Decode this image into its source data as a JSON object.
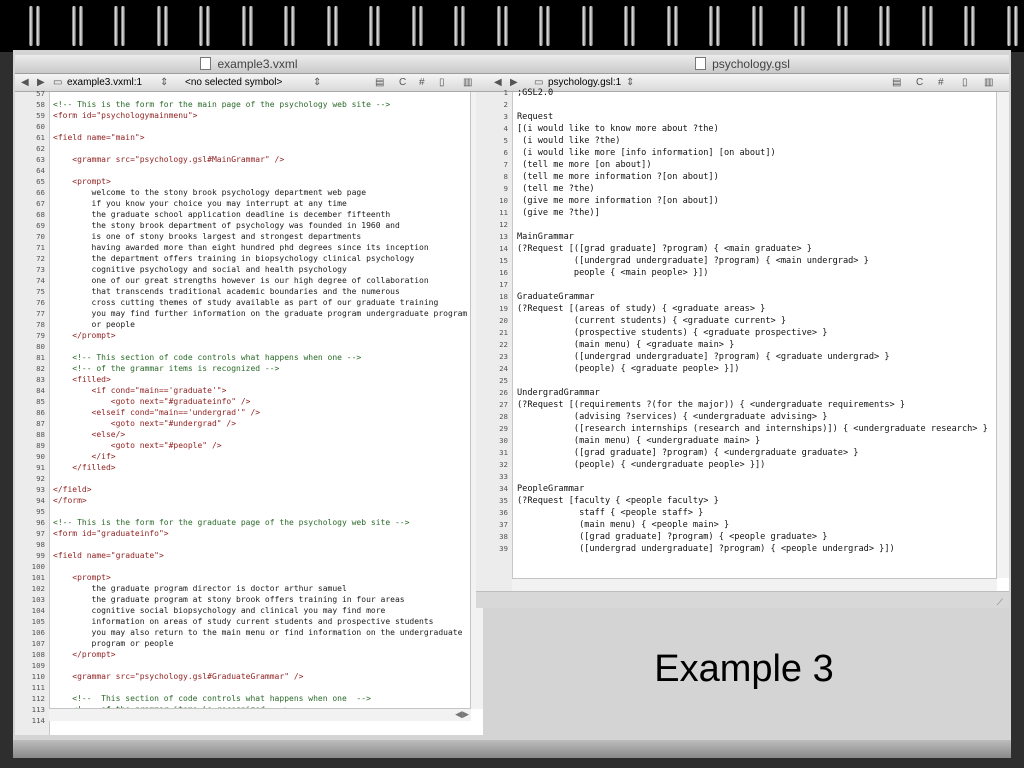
{
  "left_window": {
    "title": "example3.vxml",
    "tab_label": "example3.vxml:1",
    "symbol_label": "<no selected symbol>",
    "line_numbers": [
      "57",
      "58",
      "59",
      "60",
      "61",
      "62",
      "63",
      "64",
      "65",
      "66",
      "67",
      "68",
      "69",
      "70",
      "71",
      "72",
      "73",
      "74",
      "75",
      "76",
      "77",
      "78",
      "79",
      "80",
      "81",
      "82",
      "83",
      "84",
      "85",
      "86",
      "87",
      "88",
      "89",
      "90",
      "91",
      "92",
      "93",
      "94",
      "95",
      "96",
      "97",
      "98",
      "99",
      "100",
      "101",
      "102",
      "103",
      "104",
      "105",
      "106",
      "107",
      "108",
      "109",
      "110",
      "111",
      "112",
      "113",
      "114"
    ],
    "code_lines": [
      {
        "t": "",
        "c": ""
      },
      {
        "t": "<!-- This is the form for the main page of the psychology web site -->",
        "c": "cmt"
      },
      {
        "t": "<form id=\"psychologymainmenu\">",
        "c": "tag"
      },
      {
        "t": "",
        "c": ""
      },
      {
        "t": "<field name=\"main\">",
        "c": "tag"
      },
      {
        "t": "",
        "c": ""
      },
      {
        "t": "    <grammar src=\"psychology.gsl#MainGrammar\" />",
        "c": "tag"
      },
      {
        "t": "",
        "c": ""
      },
      {
        "t": "    <prompt>",
        "c": "tag"
      },
      {
        "t": "        welcome to the stony brook psychology department web page",
        "c": ""
      },
      {
        "t": "        if you know your choice you may interrupt at any time",
        "c": ""
      },
      {
        "t": "        the graduate school application deadline is december fifteenth",
        "c": ""
      },
      {
        "t": "        the stony brook department of psychology was founded in 1960 and",
        "c": ""
      },
      {
        "t": "        is one of stony brooks largest and strongest departments",
        "c": ""
      },
      {
        "t": "        having awarded more than eight hundred phd degrees since its inception",
        "c": ""
      },
      {
        "t": "        the department offers training in biopsychology clinical psychology",
        "c": ""
      },
      {
        "t": "        cognitive psychology and social and health psychology",
        "c": ""
      },
      {
        "t": "        one of our great strengths however is our high degree of collaboration",
        "c": ""
      },
      {
        "t": "        that transcends traditional academic boundaries and the numerous",
        "c": ""
      },
      {
        "t": "        cross cutting themes of study available as part of our graduate training",
        "c": ""
      },
      {
        "t": "        you may find further information on the graduate program undergraduate program",
        "c": ""
      },
      {
        "t": "        or people",
        "c": ""
      },
      {
        "t": "    </prompt>",
        "c": "tag"
      },
      {
        "t": "",
        "c": ""
      },
      {
        "t": "    <!-- This section of code controls what happens when one -->",
        "c": "cmt"
      },
      {
        "t": "    <!-- of the grammar items is recognized -->",
        "c": "cmt"
      },
      {
        "t": "    <filled>",
        "c": "tag"
      },
      {
        "t": "        <if cond=\"main=='graduate'\">",
        "c": "tag"
      },
      {
        "t": "            <goto next=\"#graduateinfo\" />",
        "c": "tag"
      },
      {
        "t": "        <elseif cond=\"main=='undergrad'\" />",
        "c": "tag"
      },
      {
        "t": "            <goto next=\"#undergrad\" />",
        "c": "tag"
      },
      {
        "t": "        <else/>",
        "c": "tag"
      },
      {
        "t": "            <goto next=\"#people\" />",
        "c": "tag"
      },
      {
        "t": "        </if>",
        "c": "tag"
      },
      {
        "t": "    </filled>",
        "c": "tag"
      },
      {
        "t": "",
        "c": ""
      },
      {
        "t": "</field>",
        "c": "tag"
      },
      {
        "t": "</form>",
        "c": "tag"
      },
      {
        "t": "",
        "c": ""
      },
      {
        "t": "<!-- This is the form for the graduate page of the psychology web site -->",
        "c": "cmt"
      },
      {
        "t": "<form id=\"graduateinfo\">",
        "c": "tag"
      },
      {
        "t": "",
        "c": ""
      },
      {
        "t": "<field name=\"graduate\">",
        "c": "tag"
      },
      {
        "t": "",
        "c": ""
      },
      {
        "t": "    <prompt>",
        "c": "tag"
      },
      {
        "t": "        the graduate program director is doctor arthur samuel",
        "c": ""
      },
      {
        "t": "        the graduate program at stony brook offers training in four areas",
        "c": ""
      },
      {
        "t": "        cognitive social biopsychology and clinical you may find more",
        "c": ""
      },
      {
        "t": "        information on areas of study current students and prospective students",
        "c": ""
      },
      {
        "t": "        you may also return to the main menu or find information on the undergraduate",
        "c": ""
      },
      {
        "t": "        program or people",
        "c": ""
      },
      {
        "t": "    </prompt>",
        "c": "tag"
      },
      {
        "t": "",
        "c": ""
      },
      {
        "t": "    <grammar src=\"psychology.gsl#GraduateGrammar\" />",
        "c": "tag"
      },
      {
        "t": "",
        "c": ""
      },
      {
        "t": "    <!--  This section of code controls what happens when one  -->",
        "c": "cmt"
      },
      {
        "t": "    <!--  of the grammar items is recognized  -->",
        "c": "cmt"
      },
      {
        "t": "",
        "c": ""
      }
    ]
  },
  "right_window": {
    "title": "psychology.gsl",
    "tab_label": "psychology.gsl:1",
    "line_numbers": [
      "1",
      "2",
      "3",
      "4",
      "5",
      "6",
      "7",
      "8",
      "9",
      "10",
      "11",
      "12",
      "13",
      "14",
      "15",
      "16",
      "17",
      "18",
      "19",
      "20",
      "21",
      "22",
      "23",
      "24",
      "25",
      "26",
      "27",
      "28",
      "29",
      "30",
      "31",
      "32",
      "33",
      "34",
      "35",
      "36",
      "37",
      "38",
      "39"
    ],
    "code_lines": [
      ";GSL2.0",
      "",
      "Request",
      "[(i would like to know more about ?the)",
      " (i would like ?the)",
      " (i would like more [info information] [on about])",
      " (tell me more [on about])",
      " (tell me more information ?[on about])",
      " (tell me ?the)",
      " (give me more information ?[on about])",
      " (give me ?the)]",
      "",
      "MainGrammar",
      "(?Request [([grad graduate] ?program) { <main graduate> }",
      "           ([undergrad undergraduate] ?program) { <main undergrad> }",
      "           people { <main people> }])",
      "",
      "GraduateGrammar",
      "(?Request [(areas of study) { <graduate areas> }",
      "           (current students) { <graduate current> }",
      "           (prospective students) { <graduate prospective> }",
      "           (main menu) { <graduate main> }",
      "           ([undergrad undergraduate] ?program) { <graduate undergrad> }",
      "           (people) { <graduate people> }])",
      "",
      "UndergradGrammar",
      "(?Request [(requirements ?(for the major)) { <undergraduate requirements> }",
      "           (advising ?services) { <undergraduate advising> }",
      "           ([research internships (research and internships)]) { <undergraduate research> }",
      "           (main menu) { <undergraduate main> }",
      "           ([grad graduate] ?program) { <undergraduate graduate> }",
      "           (people) { <undergraduate people> }])",
      "",
      "PeopleGrammar",
      "(?Request [faculty { <people faculty> }",
      "            staff { <people staff> }",
      "            (main menu) { <people main> }",
      "            ([grad graduate] ?program) { <people graduate> }",
      "            ([undergrad undergraduate] ?program) { <people undergrad> }])"
    ]
  },
  "slide_caption": "Example 3"
}
